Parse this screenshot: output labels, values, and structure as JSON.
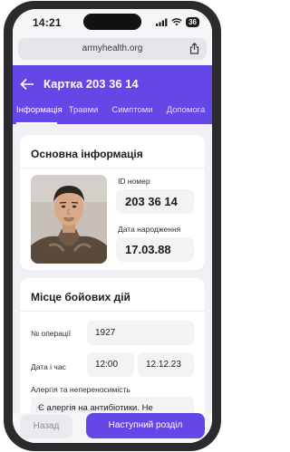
{
  "status_bar": {
    "time": "14:21",
    "battery": "36"
  },
  "browser": {
    "url": "armyhealth.org"
  },
  "header": {
    "title": "Картка 203 36 14",
    "tabs": [
      {
        "label": "Інформація",
        "active": true
      },
      {
        "label": "Травми",
        "active": false
      },
      {
        "label": "Симптоми",
        "active": false
      },
      {
        "label": "Допомога",
        "active": false
      }
    ]
  },
  "basic_info": {
    "title": "Основна інформація",
    "id_label": "ID номер",
    "id_value": "203 36 14",
    "dob_label": "Дата народження",
    "dob_value": "17.03.88"
  },
  "combat": {
    "title": "Місце бойових дій",
    "operation_label": "№ операції",
    "operation_value": "1927",
    "datetime_label": "Дата і час",
    "time_value": "12:00",
    "date_value": "12.12.23",
    "allergy_label": "Алергія та непереносимість",
    "allergy_value": "Є алергія на антибіотики. Не рекомендовано вводити препарати з"
  },
  "footer": {
    "back_label": "Назад",
    "next_label": "Наступний розділ"
  },
  "colors": {
    "accent": "#6547e8",
    "background": "#f1f1f5"
  }
}
